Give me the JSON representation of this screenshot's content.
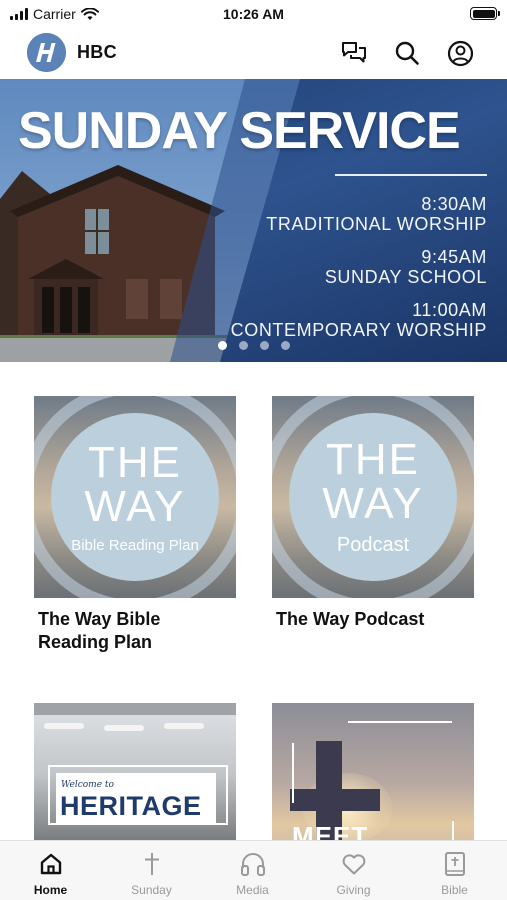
{
  "status_bar": {
    "carrier": "Carrier",
    "time": "10:26 AM"
  },
  "header": {
    "title": "HBC",
    "logo_letter": "H",
    "icons": [
      "chat-icon",
      "search-icon",
      "profile-icon"
    ]
  },
  "hero": {
    "title": "SUNDAY SERVICE",
    "schedule": [
      {
        "time": "8:30AM",
        "event": "TRADITIONAL WORSHIP"
      },
      {
        "time": "9:45AM",
        "event": "SUNDAY SCHOOL"
      },
      {
        "time": "11:00AM",
        "event": "CONTEMPORARY WORSHIP"
      }
    ],
    "carousel_pages": 4,
    "carousel_active_index": 0
  },
  "cards": [
    {
      "title": "The Way Bible Reading Plan",
      "image": {
        "line1": "THE",
        "line2": "WAY",
        "subtitle": "Bible Reading Plan"
      }
    },
    {
      "title": "The Way Podcast",
      "image": {
        "line1": "THE",
        "line2": "WAY",
        "subtitle": "Podcast"
      }
    },
    {
      "title": "",
      "image": {
        "small": "Welcome to",
        "big": "HERITAGE"
      }
    },
    {
      "title": "",
      "image": {
        "text": "MEET"
      }
    }
  ],
  "tab_bar": {
    "items": [
      {
        "label": "Home",
        "icon": "home-icon",
        "active": true
      },
      {
        "label": "Sunday",
        "icon": "cross-icon",
        "active": false
      },
      {
        "label": "Media",
        "icon": "headphones-icon",
        "active": false
      },
      {
        "label": "Giving",
        "icon": "heart-icon",
        "active": false
      },
      {
        "label": "Bible",
        "icon": "bible-icon",
        "active": false
      }
    ]
  },
  "colors": {
    "accent": "#2e538e",
    "logo": "#5b83b8",
    "tab_inactive": "#9a9a9a",
    "tab_active": "#111111"
  }
}
